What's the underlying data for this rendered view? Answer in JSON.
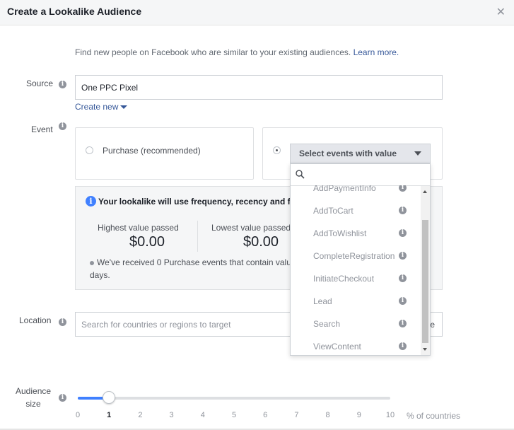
{
  "dialog": {
    "title": "Create a Lookalike Audience",
    "close_icon": "close-icon"
  },
  "intro": {
    "text": "Find new people on Facebook who are similar to your existing audiences.",
    "link": "Learn more."
  },
  "source": {
    "label": "Source",
    "value": "One PPC Pixel",
    "create_new": "Create new"
  },
  "event": {
    "label": "Event",
    "option_purchase": "Purchase (recommended)",
    "select_label": "Select events with value",
    "selected": "custom"
  },
  "info_panel": {
    "heading": "Your lookalike will use frequency, recency and f",
    "highest_label": "Highest value passed",
    "highest_value": "$0.00",
    "lowest_label": "Lowest value passed",
    "lowest_value": "$0.00",
    "note_line1": "We've received 0 Purchase events that contain valu",
    "note_line2": "days."
  },
  "dropdown": {
    "search_placeholder": "",
    "items": [
      {
        "label": "AddPaymentInfo"
      },
      {
        "label": "AddToCart"
      },
      {
        "label": "AddToWishlist"
      },
      {
        "label": "CompleteRegistration"
      },
      {
        "label": "InitiateCheckout"
      },
      {
        "label": "Lead"
      },
      {
        "label": "Search"
      },
      {
        "label": "ViewContent"
      }
    ]
  },
  "location": {
    "label": "Location",
    "placeholder": "Search for countries or regions to target",
    "trailing_partial": "e"
  },
  "audience_size": {
    "label_line1": "Audience",
    "label_line2": "size",
    "value": 1,
    "min": 0,
    "max": 10,
    "ticks": [
      "0",
      "1",
      "2",
      "3",
      "4",
      "5",
      "6",
      "7",
      "8",
      "9",
      "10"
    ],
    "unit_label": "% of countries"
  },
  "colors": {
    "accent": "#4080ff",
    "link": "#365899",
    "muted": "#90949c"
  }
}
